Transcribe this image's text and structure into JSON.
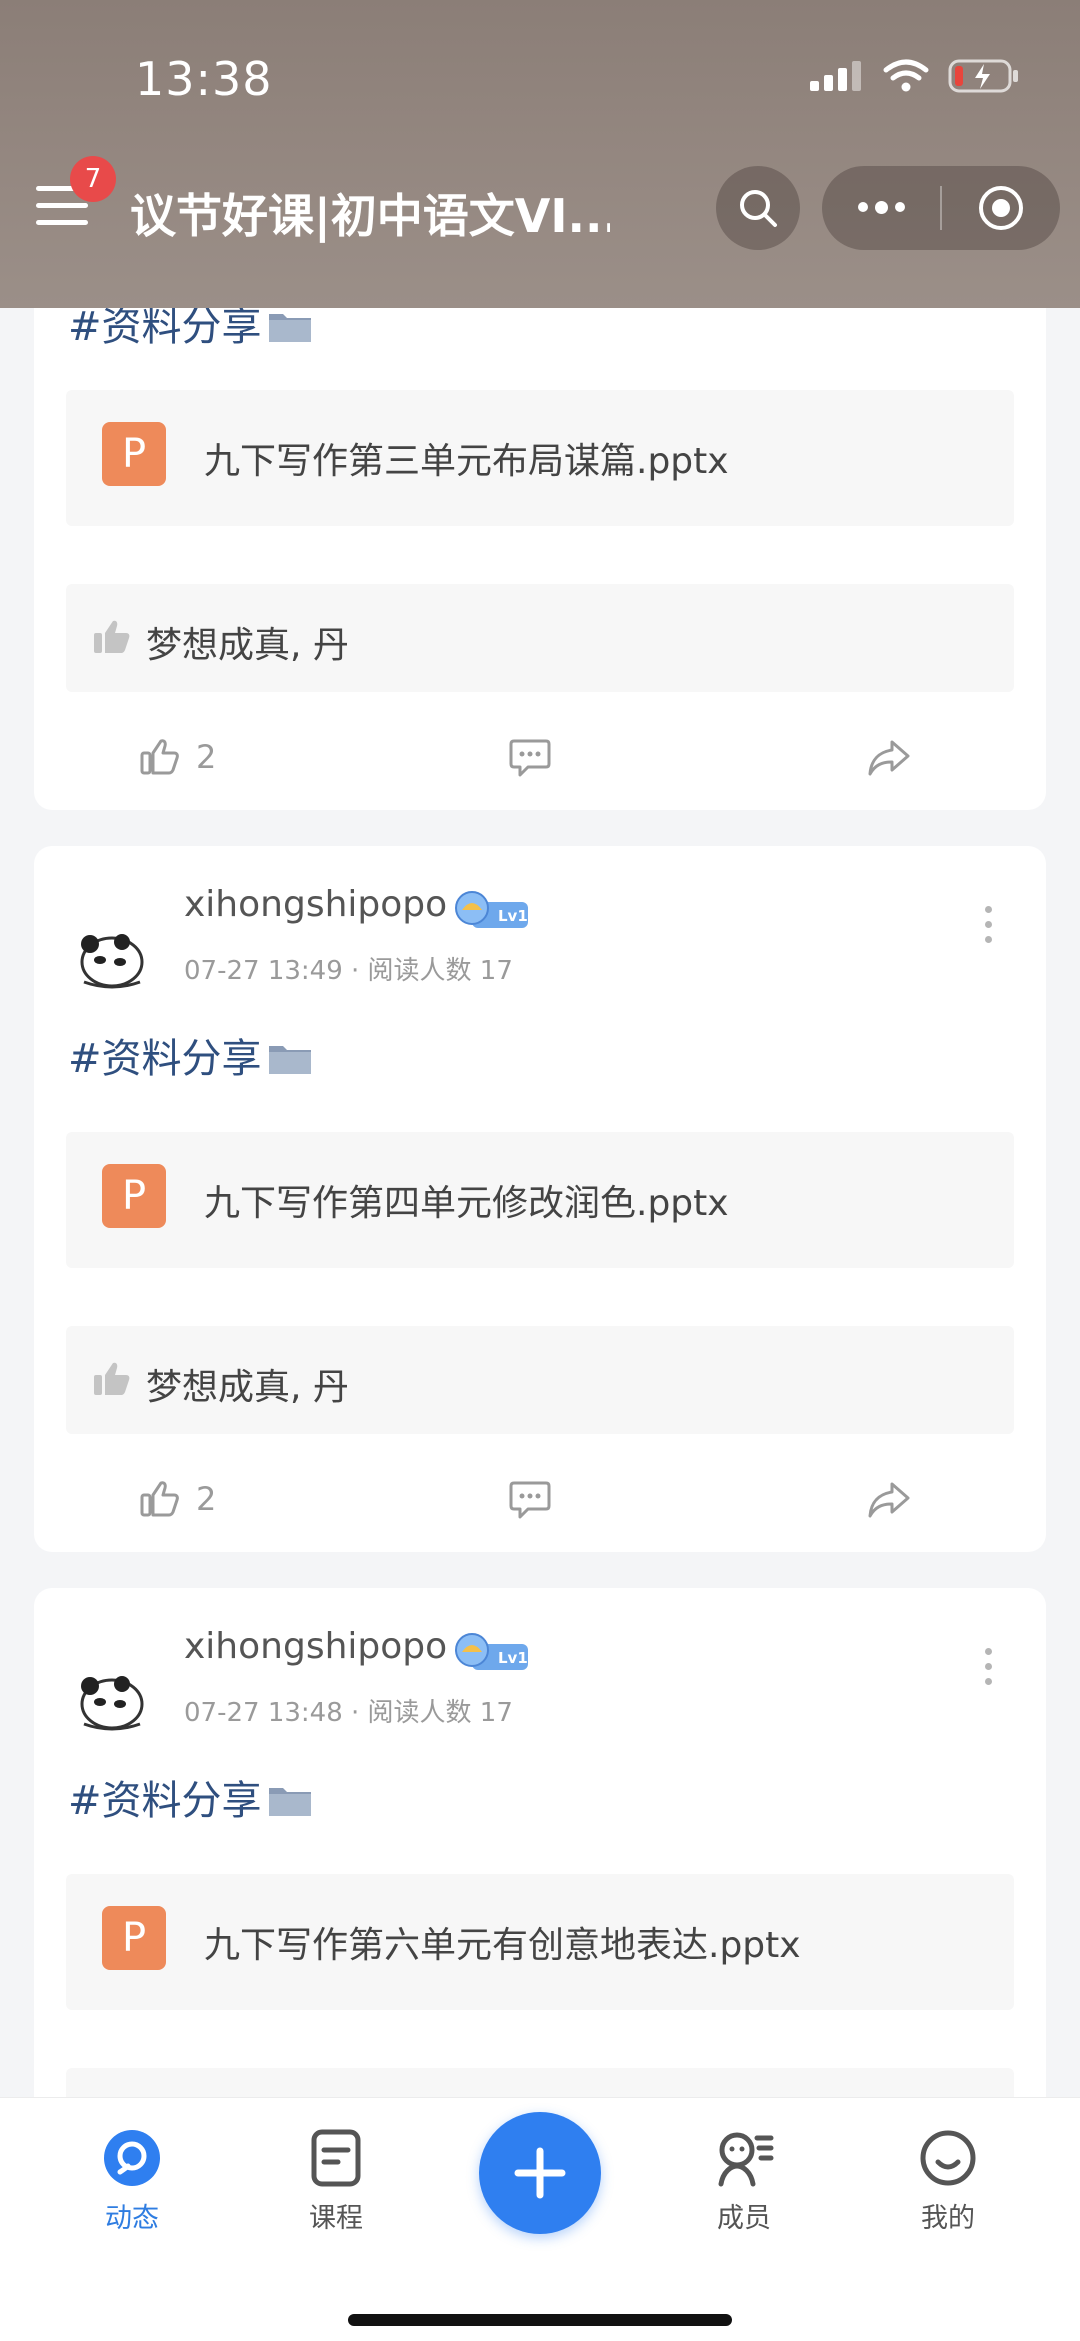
{
  "status_bar": {
    "time": "13:38"
  },
  "header": {
    "badge_count": "7",
    "title": "议节好课|初中语文VI..."
  },
  "posts": [
    {
      "tag": "#资料分享",
      "file": {
        "icon_letter": "P",
        "name": "九下写作第三单元布局谋篇.pptx"
      },
      "likers": "梦想成真, 丹",
      "like_count": "2"
    },
    {
      "author": "xihongshipopo",
      "level": "Lv1",
      "meta": "07-27 13:49 · 阅读人数 17",
      "tag": "#资料分享",
      "file": {
        "icon_letter": "P",
        "name": "九下写作第四单元修改润色.pptx"
      },
      "likers": "梦想成真, 丹",
      "like_count": "2"
    },
    {
      "author": "xihongshipopo",
      "level": "Lv1",
      "meta": "07-27 13:48 · 阅读人数 17",
      "tag": "#资料分享",
      "file": {
        "icon_letter": "P",
        "name": "九下写作第六单元有创意地表达.pptx"
      }
    }
  ],
  "bottom_nav": {
    "items": [
      {
        "label": "动态",
        "icon": "feed-icon",
        "active": true
      },
      {
        "label": "课程",
        "icon": "course-icon"
      },
      {
        "label": "成员",
        "icon": "members-icon"
      },
      {
        "label": "我的",
        "icon": "profile-icon"
      }
    ],
    "fab_icon": "plus-icon"
  },
  "colors": {
    "accent": "#2f7ff0",
    "tag_text": "#2f4f7f",
    "file_icon": "#ee8a5a",
    "badge": "#e84a4a"
  }
}
